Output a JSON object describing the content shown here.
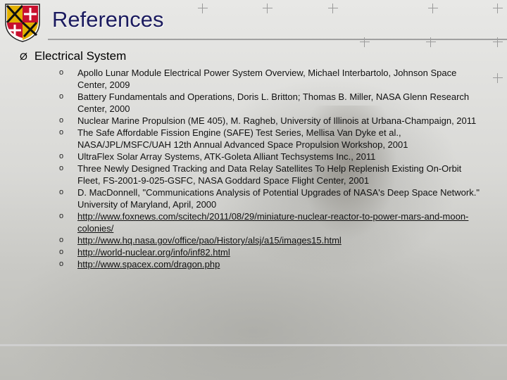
{
  "slide": {
    "title": "References",
    "section": "Electrical System",
    "section_arrow": "Ø",
    "bullet_char": "o"
  },
  "references": [
    {
      "text": "Apollo Lunar Module Electrical Power System Overview, Michael Interbartolo, Johnson Space Center, 2009",
      "link": false
    },
    {
      "text": "Battery Fundamentals and Operations, Doris L. Britton; Thomas B. Miller, NASA Glenn Research Center, 2000",
      "link": false
    },
    {
      "text": "Nuclear Marine Propulsion (ME 405), M. Ragheb, University of Illinois at Urbana-Champaign, 2011",
      "link": false
    },
    {
      "text": "The Safe Affordable Fission Engine (SAFE) Test Series, Mellisa Van Dyke et al., NASA/JPL/MSFC/UAH 12th Annual Advanced Space Propulsion Workshop, 2001",
      "link": false
    },
    {
      "text": "UltraFlex Solar Array Systems, ATK-Goleta Alliant Techsystems Inc., 2011",
      "link": false
    },
    {
      "text": "Three Newly Designed Tracking and Data Relay Satellites To Help Replenish Existing On-Orbit Fleet, FS-2001-9-025-GSFC, NASA Goddard Space Flight Center, 2001",
      "link": false
    },
    {
      "text": "D. MacDonnell, \"Communications Analysis of Potential Upgrades of NASA's Deep Space Network.\" University of Maryland, April, 2000",
      "link": false
    },
    {
      "text": "http://www.foxnews.com/scitech/2011/08/29/miniature-nuclear-reactor-to-power-mars-and-moon-colonies/",
      "link": true
    },
    {
      "text": "http://www.hq.nasa.gov/office/pao/History/alsj/a15/images15.html",
      "link": true
    },
    {
      "text": "http://world-nuclear.org/info/inf82.html",
      "link": true
    },
    {
      "text": "http://www.spacex.com/dragon.php",
      "link": true
    }
  ]
}
